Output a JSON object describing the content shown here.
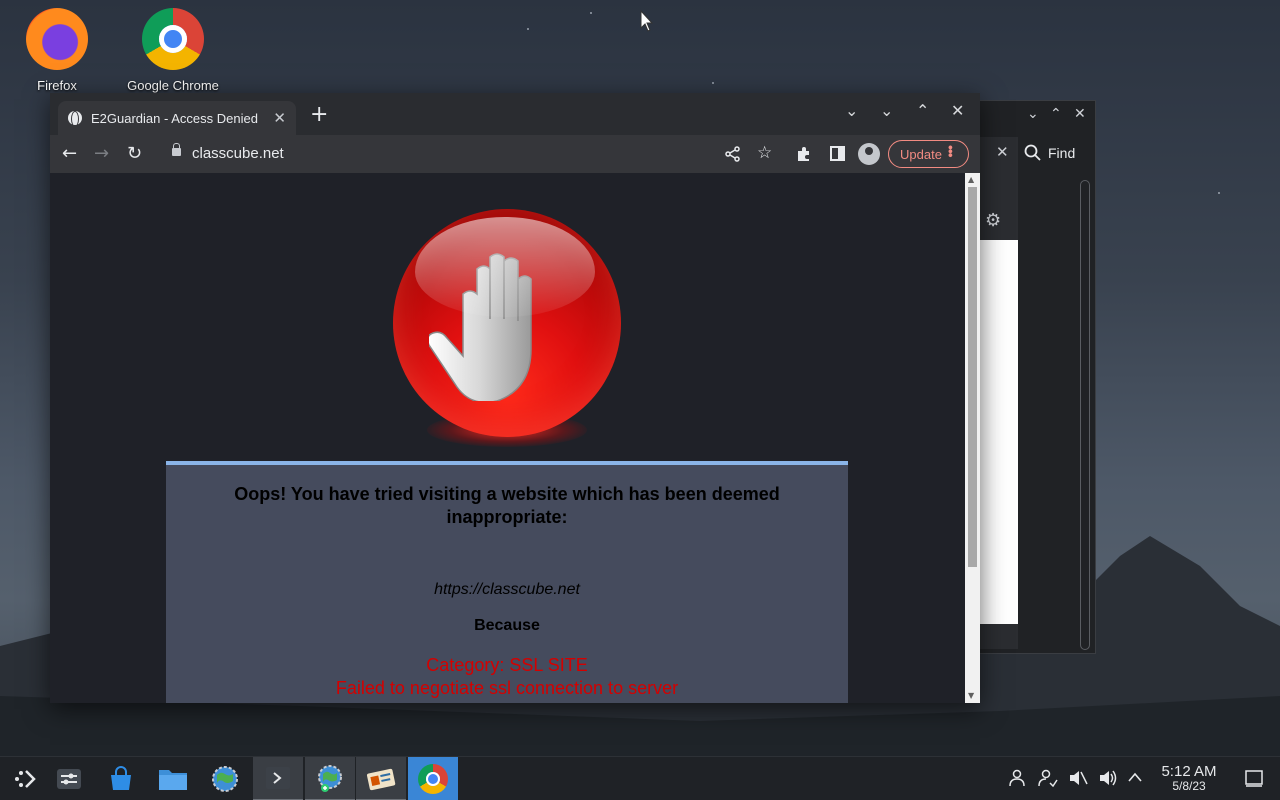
{
  "desktop": {
    "icons": [
      {
        "label": "Firefox"
      },
      {
        "label": "Google Chrome"
      }
    ]
  },
  "browser": {
    "tab_title": "E2Guardian - Access Denied",
    "tab_close": "✕",
    "new_tab": "+",
    "url": "classcube.net",
    "update_label": "Update",
    "window_controls": {
      "tab_search": "⌄",
      "minimize": "⌄",
      "maximize": "⌃",
      "close": "✕"
    }
  },
  "back_window": {
    "find_label": "Find",
    "close": "✕"
  },
  "page": {
    "heading": "Oops! You have tried visiting a website which has been deemed inappropriate:",
    "blocked_url": "https://classcube.net",
    "because": "Because",
    "category": "Category: SSL SITE",
    "reason": "Failed to negotiate ssl connection to server"
  },
  "taskbar": {
    "time": "5:12 AM",
    "date": "5/8/23"
  },
  "colors": {
    "accent": "#3a86d6",
    "update": "#f28b82",
    "error_text": "#d40000",
    "box_top_border": "#8ab4e8"
  }
}
